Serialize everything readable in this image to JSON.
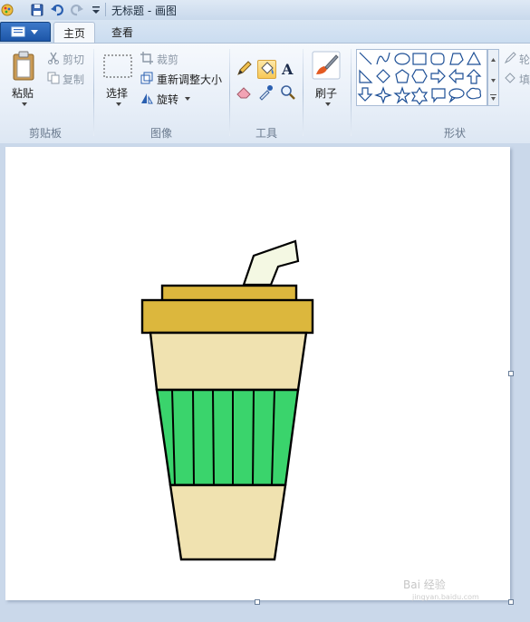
{
  "window": {
    "title": "无标题 - 画图"
  },
  "tabs": {
    "home": "主页",
    "view": "查看"
  },
  "ribbon": {
    "clipboard": {
      "label": "剪贴板",
      "paste": "粘贴",
      "cut": "剪切",
      "copy": "复制"
    },
    "image": {
      "label": "图像",
      "select": "选择",
      "crop": "裁剪",
      "resize": "重新调整大小",
      "rotate": "旋转"
    },
    "tools": {
      "label": "工具"
    },
    "brush": {
      "label": "刷子"
    },
    "shapes": {
      "label": "形状",
      "outline_partial": "轮",
      "fill_partial": "填"
    }
  },
  "drawing": {
    "colors": {
      "straw": "#f4f8e3",
      "lid": "#dcb73d",
      "cup": "#f0e2b0",
      "sleeve": "#3ad46c",
      "outline": "#000000"
    }
  },
  "watermark": {
    "text": "Bai 经验",
    "sub": "jingyan.baidu.com"
  },
  "accent": "#1e5aa8"
}
